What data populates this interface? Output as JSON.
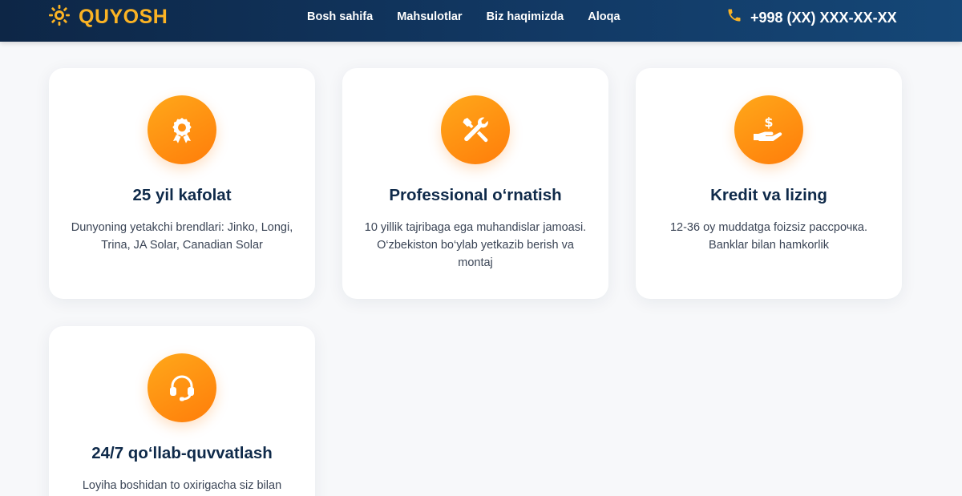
{
  "header": {
    "logo_text": "QUYOSH",
    "nav": [
      "Bosh sahifa",
      "Mahsulotlar",
      "Biz haqimizda",
      "Aloqa"
    ],
    "phone": "+998 (XX) XXX-XX-XX"
  },
  "colors": {
    "header_bg": "#0d2646",
    "accent": "#fbb324",
    "icon_gradient_start": "#ffa81a",
    "icon_gradient_end": "#ff7d0a",
    "title": "#0f2a4a",
    "text": "#3b4556"
  },
  "features": [
    {
      "icon": "award-medal-icon",
      "title": "25 yil kafolat",
      "description": "Dunyoning yetakchi brendlari: Jinko, Longi, Trina, JA Solar, Canadian Solar"
    },
    {
      "icon": "tools-icon",
      "title": "Professional o‘rnatish",
      "description": "10 yillik tajribaga ega muhandislar jamoasi. O‘zbekiston bo‘ylab yetkazib berish va montaj"
    },
    {
      "icon": "hand-dollar-icon",
      "title": "Kredit va lizing",
      "description": "12-36 oy muddatga foizsiz рассрочка. Banklar bilan hamkorlik"
    },
    {
      "icon": "headset-icon",
      "title": "24/7 qo‘llab-quvvatlash",
      "description": "Loyiha boshidan to oxirigacha siz bilan"
    }
  ]
}
